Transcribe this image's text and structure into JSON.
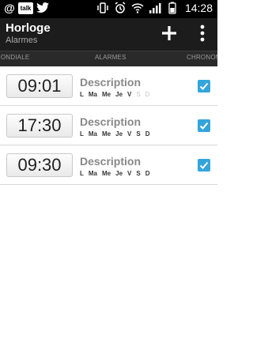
{
  "statusbar": {
    "time": "14:28",
    "talk": "talk",
    "at": "@"
  },
  "header": {
    "title": "Horloge",
    "subtitle": "Alarmes"
  },
  "tabs": [
    "MONDIALE",
    "ALARMES",
    "CHRONOMÈTRE"
  ],
  "alarms": [
    {
      "time": "09:01",
      "description": "Description",
      "days": [
        {
          "label": "L",
          "on": true
        },
        {
          "label": "Ma",
          "on": true
        },
        {
          "label": "Me",
          "on": true
        },
        {
          "label": "Je",
          "on": true
        },
        {
          "label": "V",
          "on": true
        },
        {
          "label": "S",
          "on": false
        },
        {
          "label": "D",
          "on": false
        }
      ],
      "enabled": true
    },
    {
      "time": "17:30",
      "description": "Description",
      "days": [
        {
          "label": "L",
          "on": true
        },
        {
          "label": "Ma",
          "on": true
        },
        {
          "label": "Me",
          "on": true
        },
        {
          "label": "Je",
          "on": true
        },
        {
          "label": "V",
          "on": true
        },
        {
          "label": "S",
          "on": true
        },
        {
          "label": "D",
          "on": true
        }
      ],
      "enabled": true
    },
    {
      "time": "09:30",
      "description": "Description",
      "days": [
        {
          "label": "L",
          "on": true
        },
        {
          "label": "Ma",
          "on": true
        },
        {
          "label": "Me",
          "on": true
        },
        {
          "label": "Je",
          "on": true
        },
        {
          "label": "V",
          "on": true
        },
        {
          "label": "S",
          "on": true
        },
        {
          "label": "D",
          "on": true
        }
      ],
      "enabled": true
    }
  ],
  "colors": {
    "accent": "#34a5dc",
    "actionbar": "#1c1c1c"
  }
}
